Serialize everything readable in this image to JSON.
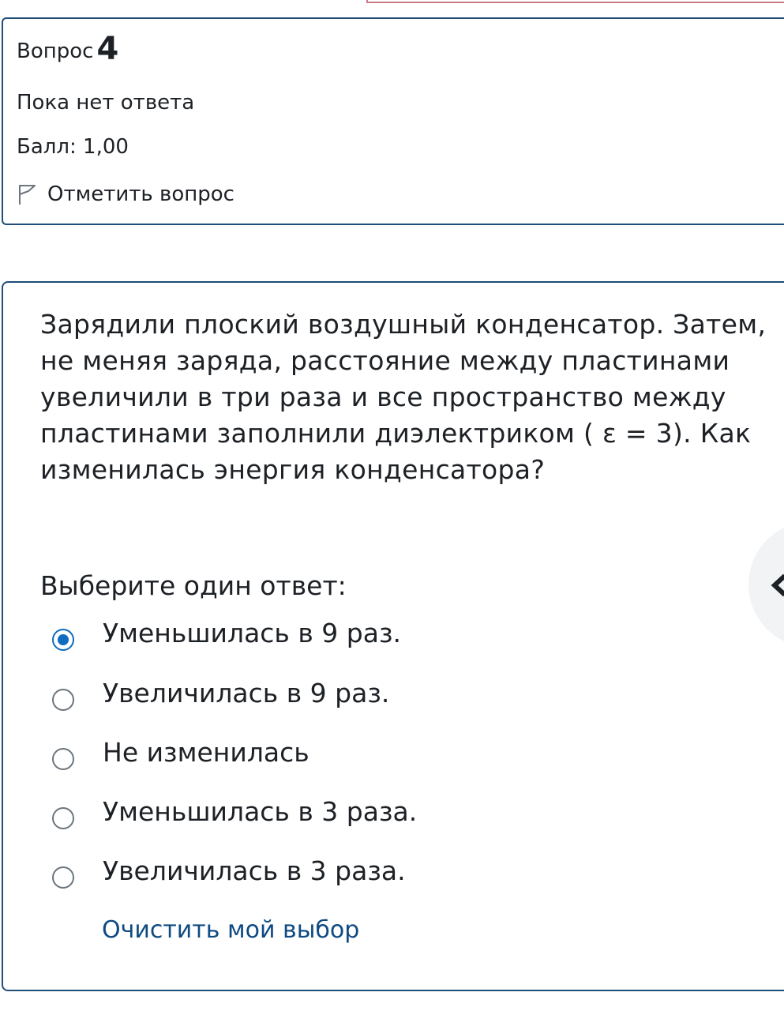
{
  "question_info": {
    "label": "Вопрос",
    "number": "4",
    "state": "Пока нет ответа",
    "grade": "Балл: 1,00",
    "flag_label": "Отметить вопрос"
  },
  "question": {
    "text": "Зарядили плоский воздушный конденсатор. Затем, не меняя заряда, расстояние между пластинами увеличили в три раза и все пространство между пластинами заполнили диэлектриком ( ε  = 3).  Как изменилась энергия конденсатора?",
    "prompt": "Выберите один ответ:",
    "options": [
      {
        "label": "Уменьшилась в 9 раз.",
        "selected": true
      },
      {
        "label": "Увеличилась в 9 раз.",
        "selected": false
      },
      {
        "label": "Не изменилась",
        "selected": false
      },
      {
        "label": "Уменьшилась в 3 раза.",
        "selected": false
      },
      {
        "label": "Увеличилась в 3 раза.",
        "selected": false
      }
    ],
    "clear_label": "Очистить мой выбор"
  },
  "icons": {
    "flag": "flag-icon",
    "drawer_toggle": "chevron-left-icon"
  },
  "colors": {
    "border": "#1f4e79",
    "accent": "#0f6cbf",
    "link": "#0f4a82"
  }
}
